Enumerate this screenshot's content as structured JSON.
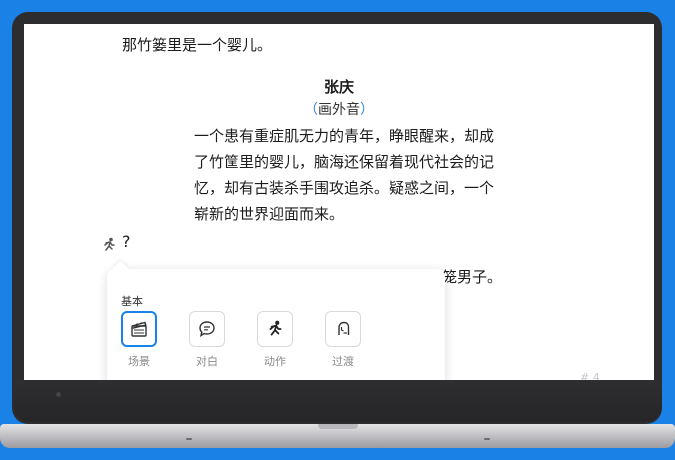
{
  "script": {
    "line_top": "那竹篓里是一个婴儿。",
    "character_name": "张庆",
    "parenthetical_open": "（",
    "parenthetical_text": "画外音",
    "parenthetical_close": "）",
    "dialogue_lines": [
      "一个患有重症肌无力的青年，睁眼醒来，却成",
      "了竹筐里的婴儿，脑海还保留着现代社会的记",
      "忆，却有古装杀手围攻追杀。疑惑之间，一个",
      "崭新的世界迎面而来。"
    ],
    "current_line": "?",
    "obscured_line_tail": "笼男子。",
    "page_number": "# 4"
  },
  "popup": {
    "section_label": "基本",
    "items": [
      {
        "label": "场景",
        "icon": "clapperboard-icon"
      },
      {
        "label": "对白",
        "icon": "speech-bubble-icon"
      },
      {
        "label": "动作",
        "icon": "running-person-icon"
      },
      {
        "label": "过渡",
        "icon": "transition-icon"
      }
    ],
    "accent_color": "#1a82e6"
  }
}
